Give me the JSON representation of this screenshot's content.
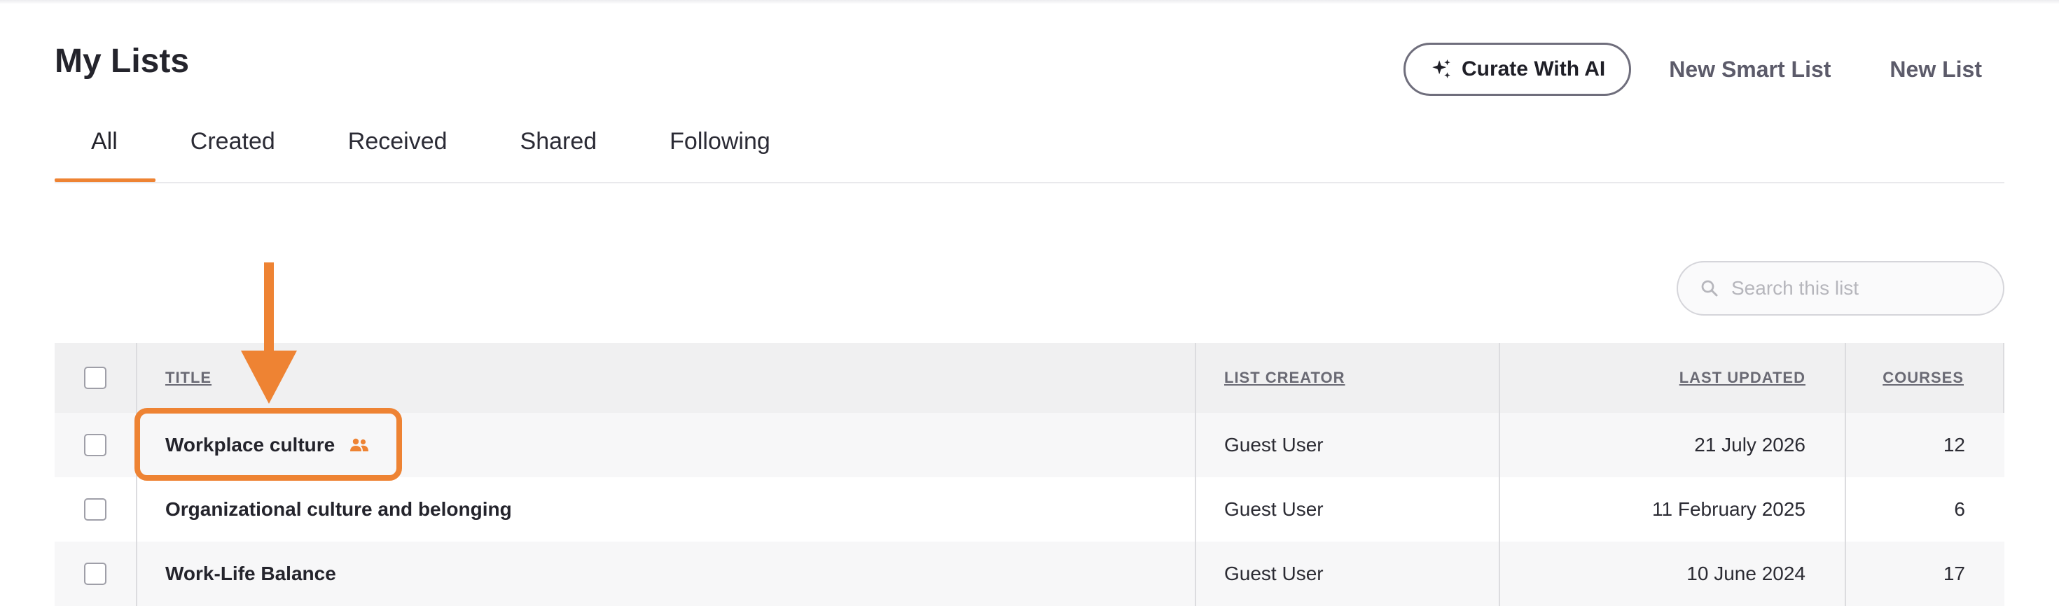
{
  "page": {
    "title": "My Lists"
  },
  "actions": {
    "curate_ai": "Curate With AI",
    "new_smart_list": "New Smart List",
    "new_list": "New List"
  },
  "tabs": [
    {
      "label": "All",
      "active": true
    },
    {
      "label": "Created"
    },
    {
      "label": "Received"
    },
    {
      "label": "Shared"
    },
    {
      "label": "Following"
    }
  ],
  "search": {
    "placeholder": "Search this list",
    "value": ""
  },
  "table": {
    "headers": {
      "title": "TITLE",
      "creator": "LIST CREATOR",
      "updated": "LAST UPDATED",
      "courses": "COURSES"
    },
    "rows": [
      {
        "title": "Workplace culture",
        "shared_icon": "people-icon",
        "creator": "Guest User",
        "updated": "21 July 2026",
        "courses": "12"
      },
      {
        "title": "Organizational culture and belonging",
        "creator": "Guest User",
        "updated": "11 February 2025",
        "courses": "6"
      },
      {
        "title": "Work-Life Balance",
        "creator": "Guest User",
        "updated": "10 June 2024",
        "courses": "17"
      }
    ]
  },
  "colors": {
    "accent": "#ee8333",
    "text": "#24242c",
    "muted": "#5c5b6a"
  }
}
